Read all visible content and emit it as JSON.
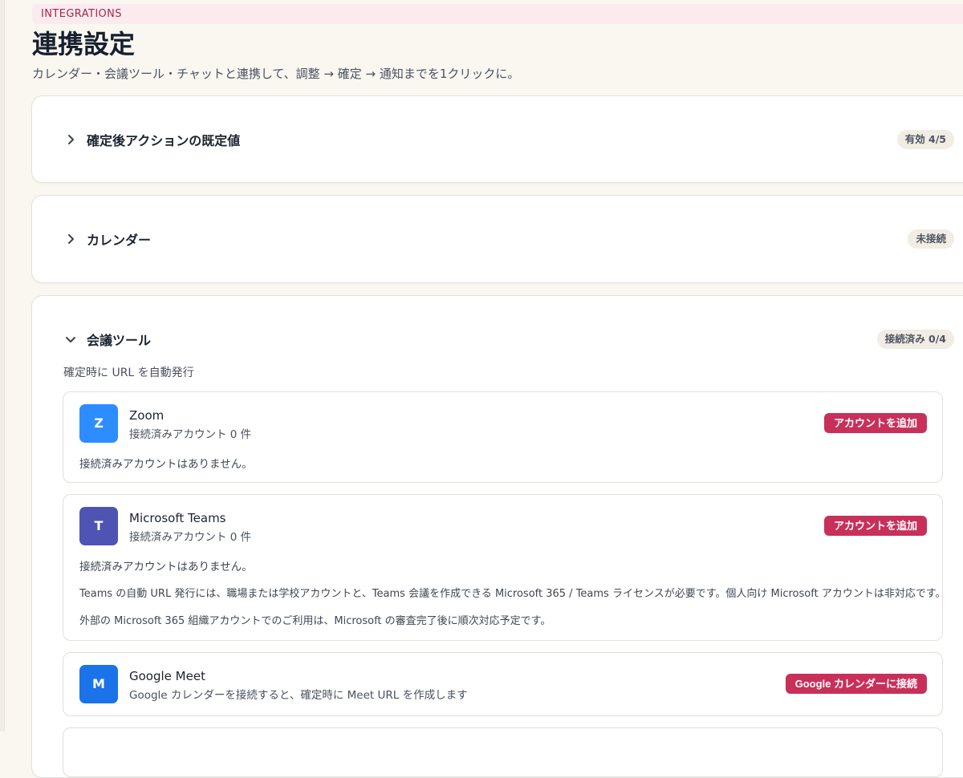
{
  "eyebrow": "INTEGRATIONS",
  "title": "連携設定",
  "subtitle": "カレンダー・会議ツール・チャットと連携して、調整 → 確定 → 通知までを1クリックに。",
  "sections": {
    "defaults": {
      "title": "確定後アクションの既定値",
      "badge": "有効 4/5",
      "expanded": false
    },
    "calendar": {
      "title": "カレンダー",
      "badge": "未接続",
      "expanded": false
    },
    "meeting": {
      "title": "会議ツール",
      "badge": "接続済み 0/4",
      "expanded": true,
      "description": "確定時に URL を自動発行",
      "tools": {
        "zoom": {
          "icon_letter": "Z",
          "icon_color": "#2d8cff",
          "name": "Zoom",
          "sub": "接続済みアカウント 0 件",
          "button": "アカウントを追加",
          "empty": "接続済みアカウントはありません。"
        },
        "teams": {
          "icon_letter": "T",
          "icon_color": "#4f53b3",
          "name": "Microsoft Teams",
          "sub": "接続済みアカウント 0 件",
          "button": "アカウントを追加",
          "empty": "接続済みアカウントはありません。",
          "note1": "Teams の自動 URL 発行には、職場または学校アカウントと、Teams 会議を作成できる Microsoft 365 / Teams ライセンスが必要です。個人向け Microsoft アカウントは非対応です。",
          "note2": "外部の Microsoft 365 組織アカウントでのご利用は、Microsoft の審査完了後に順次対応予定です。"
        },
        "meet": {
          "icon_letter": "M",
          "icon_color": "#1a73e8",
          "name": "Google Meet",
          "sub": "Google カレンダーを接続すると、確定時に Meet URL を作成します",
          "button": "Google カレンダーに接続"
        }
      }
    }
  },
  "colors": {
    "accent": "#c8305a",
    "background": "#faf7f1"
  },
  "icons": {
    "collapsed": "chevron-right-icon",
    "expanded": "chevron-down-icon"
  }
}
